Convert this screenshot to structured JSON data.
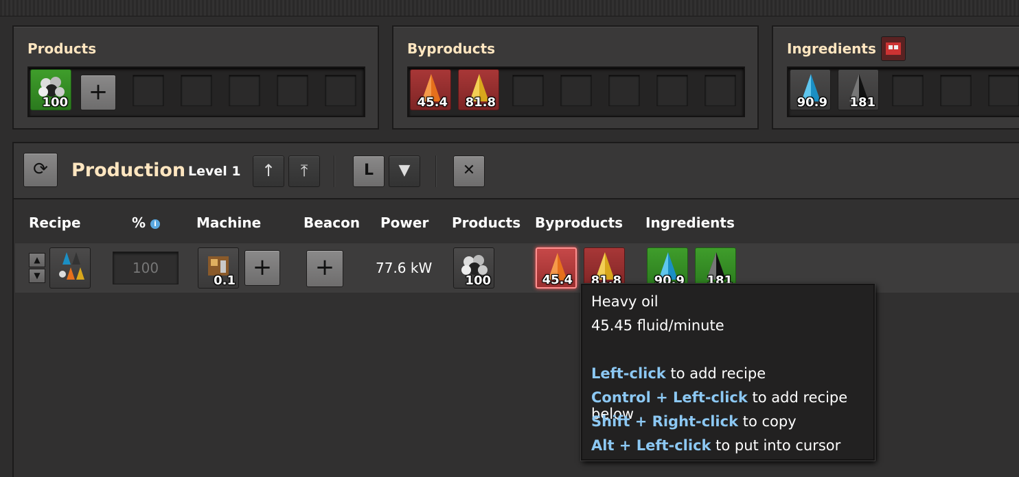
{
  "top_panels": {
    "products": {
      "title": "Products",
      "items": [
        {
          "icon": "petroleum-gas-icon",
          "count": "100",
          "bg": "green"
        }
      ]
    },
    "byproducts": {
      "title": "Byproducts",
      "items": [
        {
          "icon": "heavy-oil-icon",
          "count": "45.4",
          "bg": "red"
        },
        {
          "icon": "light-oil-icon",
          "count": "81.8",
          "bg": "red"
        }
      ]
    },
    "ingredients": {
      "title": "Ingredients",
      "items": [
        {
          "icon": "water-icon",
          "count": "90.9",
          "bg": "dark"
        },
        {
          "icon": "crude-oil-icon",
          "count": "181",
          "bg": "dark"
        }
      ]
    }
  },
  "production": {
    "title": "Production",
    "level": "Level 1",
    "columns": {
      "recipe": "Recipe",
      "percent": "%",
      "machine": "Machine",
      "beacon": "Beacon",
      "power": "Power",
      "products": "Products",
      "byproducts": "Byproducts",
      "ingredients": "Ingredients"
    },
    "row": {
      "percent_value": "100",
      "machine_count": "0.1",
      "power": "77.6 kW",
      "product_count": "100",
      "byproduct_counts": [
        "45.4",
        "81.8"
      ],
      "ingredient_counts": [
        "90.9",
        "181"
      ]
    }
  },
  "tooltip": {
    "title": "Heavy oil",
    "rate": "45.45 fluid/minute",
    "hints": [
      {
        "key": "Left-click",
        "text": " to add recipe"
      },
      {
        "key": "Control + Left-click",
        "text": " to add recipe below"
      },
      {
        "key": "Shift + Right-click",
        "text": " to copy"
      },
      {
        "key": "Alt + Left-click",
        "text": " to put into cursor"
      }
    ]
  },
  "colors": {
    "title": "#ffe6c0",
    "hint_key": "#8cc8f3",
    "green_slot": "#3f9d2b",
    "red_slot": "#a83737"
  }
}
